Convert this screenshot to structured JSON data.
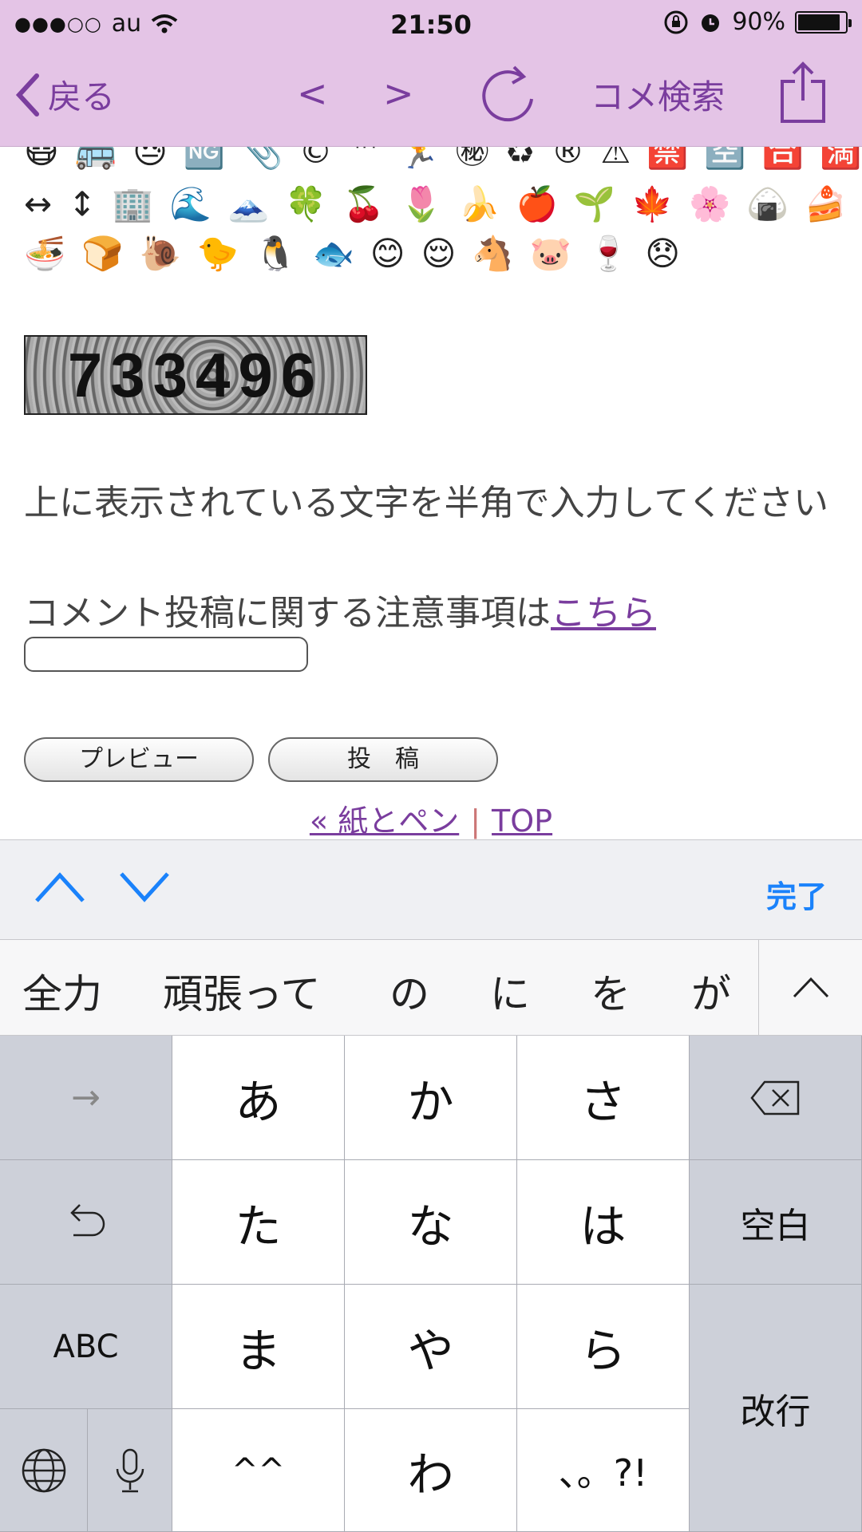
{
  "status_bar": {
    "carrier": "au",
    "time": "21:50",
    "battery": "90%",
    "battery_level": 0.9
  },
  "nav": {
    "back": "戻る",
    "prev": "<",
    "next": ">",
    "search": "コメ検索"
  },
  "emoji": {
    "row1": [
      "😷",
      "🚌",
      "😓",
      "🆖",
      "📎",
      "©",
      "™",
      "🏃",
      "㊙",
      "♻",
      "®",
      "⚠",
      "🈲",
      "🈳",
      "🈴",
      "🈵"
    ],
    "row2": [
      "↔",
      "↕",
      "🏢",
      "🌊",
      "🗻",
      "🍀",
      "🍒",
      "🌷",
      "🍌",
      "🍎",
      "🌱",
      "🍁",
      "🌸",
      "🍙",
      "🍰",
      "🍶"
    ],
    "row3": [
      "🍜",
      "🍞",
      "🐌",
      "🐤",
      "🐧",
      "🐟",
      "😊",
      "😌",
      "🐴",
      "🐷",
      "🍷",
      "😞"
    ]
  },
  "captcha": "733496",
  "instruction": "上に表示されている文字を半角で入力してください",
  "notice": {
    "text": "コメント投稿に関する注意事項は",
    "link": "こちら"
  },
  "buttons": {
    "preview": "プレビュー",
    "post": "投稿"
  },
  "links": {
    "prev_link": "« 紙とペン",
    "separator": "|",
    "top": "TOP"
  },
  "accessory": {
    "done": "完了"
  },
  "candidates": [
    "全力",
    "頑張って",
    "の",
    "に",
    "を",
    "が"
  ],
  "keyboard": {
    "kana": [
      "あ",
      "か",
      "さ",
      "た",
      "な",
      "は",
      "ま",
      "や",
      "ら",
      "^^",
      "わ",
      "、。?!"
    ],
    "space": "空白",
    "abc": "ABC",
    "enter": "改行",
    "next_arrow": "→"
  }
}
